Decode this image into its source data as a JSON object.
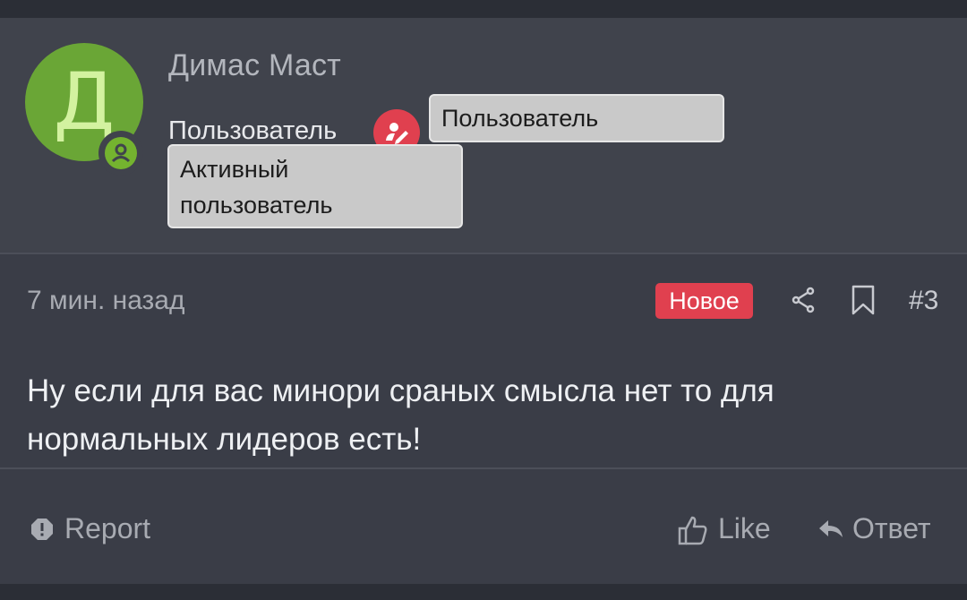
{
  "author": {
    "avatar_letter": "Д",
    "avatar_color": "#6aa636",
    "name": "Димас Маст",
    "role": "Пользователь",
    "badges": [
      "Пользователь",
      "Активный\nпользователь"
    ]
  },
  "meta": {
    "time": "7 мин. назад",
    "new_label": "Новое",
    "post_number": "#3",
    "accent_color": "#e0404f"
  },
  "message": "Ну если для вас минори сраных смысла нет то для нормальных лидеров есть!",
  "actions": {
    "report_label": "Report",
    "like_label": "Like",
    "reply_label": "Ответ"
  }
}
